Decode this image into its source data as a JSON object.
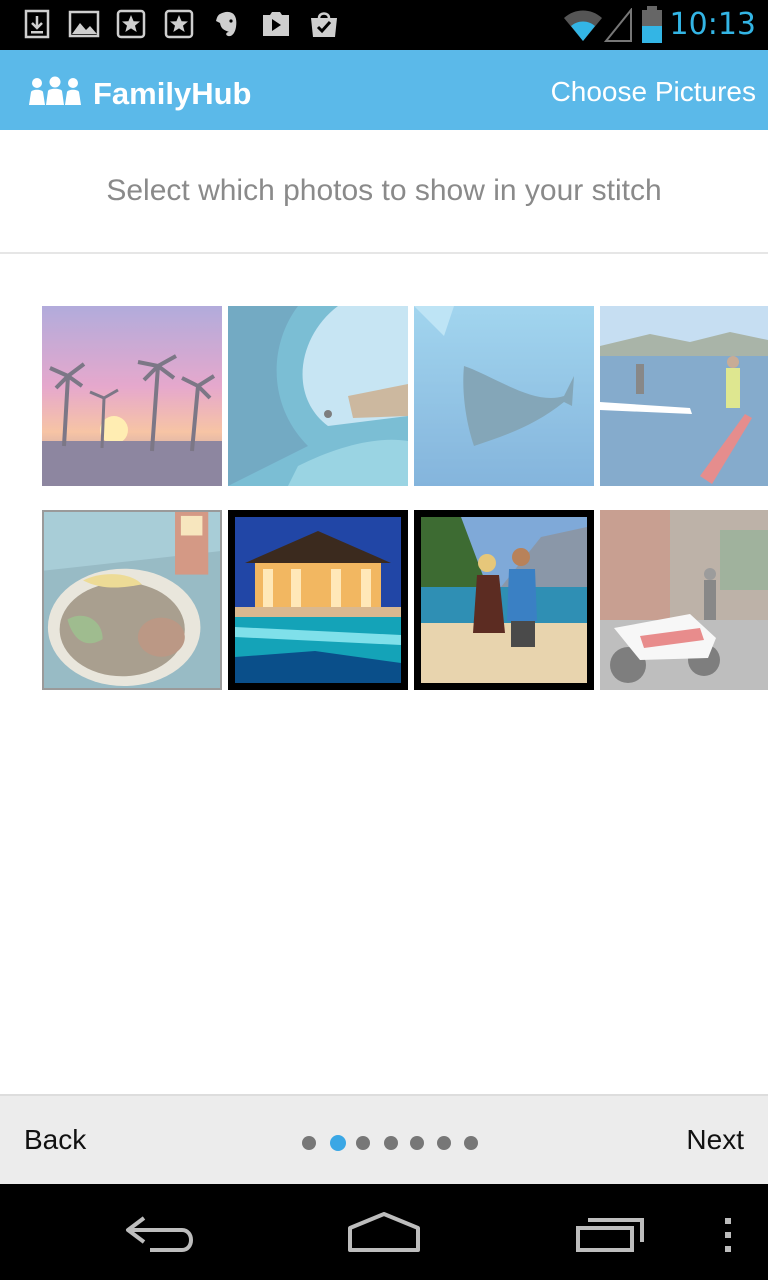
{
  "status_bar": {
    "time": "10:13",
    "icons": [
      "download-icon",
      "image-icon",
      "star-box-icon",
      "star-box-icon",
      "evernote-icon",
      "play-store-icon",
      "shopping-bag-icon",
      "wifi-icon",
      "signal-icon",
      "battery-icon"
    ]
  },
  "action_bar": {
    "app_title": "FamilyHub",
    "screen_title": "Choose Pictures",
    "color": "#5bb9e9"
  },
  "instruction": "Select which photos to show in your stitch",
  "photos": [
    {
      "subject": "sunset-palms",
      "selected": false
    },
    {
      "subject": "surf-wave",
      "selected": false
    },
    {
      "subject": "whale-underwater",
      "selected": false
    },
    {
      "subject": "paddle-board",
      "selected": false
    },
    {
      "subject": "food-plate",
      "selected": false
    },
    {
      "subject": "resort-pool",
      "selected": true
    },
    {
      "subject": "beach-couple",
      "selected": true
    },
    {
      "subject": "police-motorcycle",
      "selected": false
    }
  ],
  "bottom_bar": {
    "back_label": "Back",
    "next_label": "Next",
    "page_count": 7,
    "current_page": 2,
    "accent": "#3aa7e5"
  },
  "system_nav": {
    "icons": [
      "back-icon",
      "home-icon",
      "recent-apps-icon",
      "overflow-menu-icon"
    ]
  }
}
